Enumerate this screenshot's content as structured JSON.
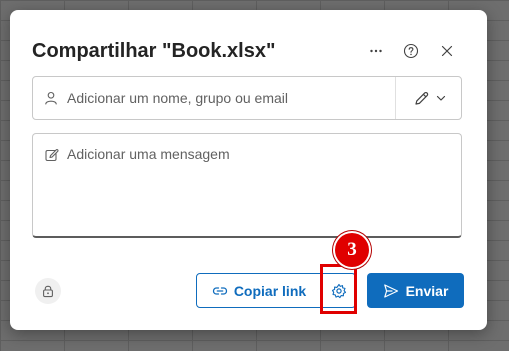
{
  "dialog": {
    "title": "Compartilhar \"Book.xlsx\"",
    "header_icons": [
      "more-icon",
      "help-icon",
      "close-icon"
    ]
  },
  "recipients": {
    "placeholder": "Adicionar um nome, grupo ou email",
    "value": "",
    "permission_icon": "edit-pencil-icon"
  },
  "message": {
    "placeholder": "Adicionar uma mensagem",
    "value": ""
  },
  "footer": {
    "copy_link_label": "Copiar link",
    "send_label": "Enviar",
    "lock_icon": "lock-icon",
    "settings_icon": "gear-icon"
  },
  "annotation": {
    "step_number": "3"
  },
  "colors": {
    "accent": "#0f6cbd",
    "highlight": "#e00000"
  }
}
